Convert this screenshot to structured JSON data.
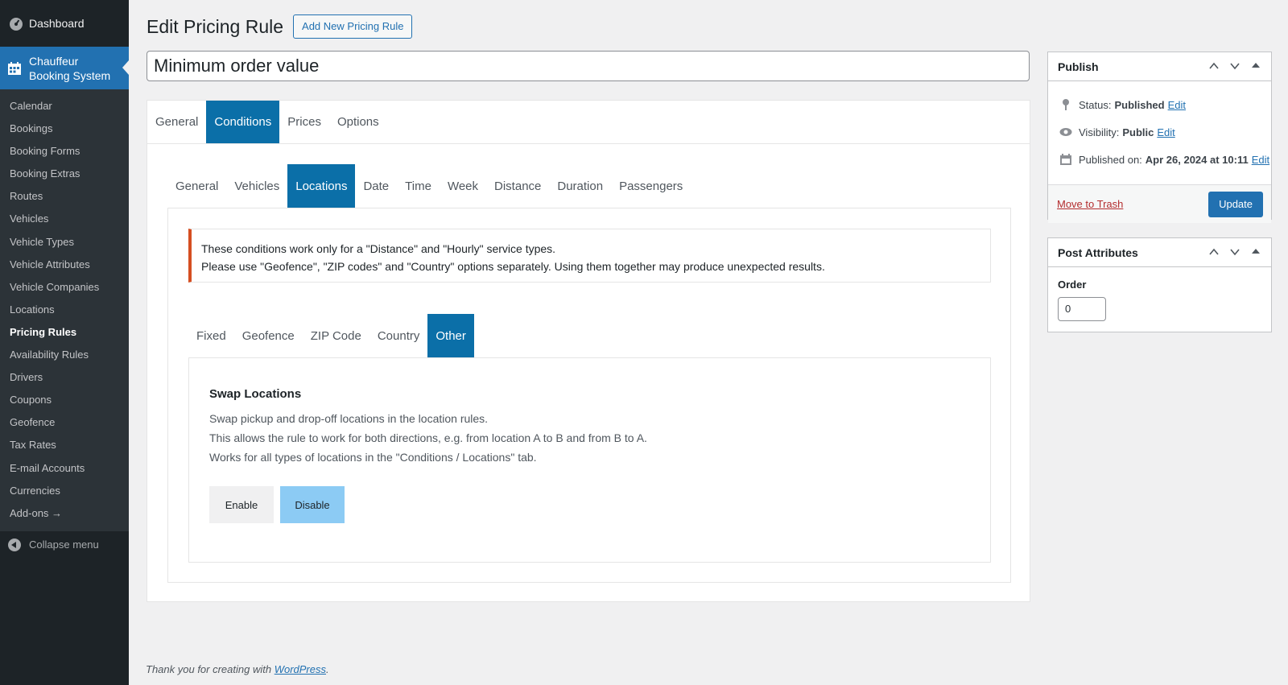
{
  "sidebar": {
    "dashboard": "Dashboard",
    "active_plugin": "Chauffeur Booking System",
    "items": [
      {
        "label": "Calendar"
      },
      {
        "label": "Bookings"
      },
      {
        "label": "Booking Forms"
      },
      {
        "label": "Booking Extras"
      },
      {
        "label": "Routes"
      },
      {
        "label": "Vehicles"
      },
      {
        "label": "Vehicle Types"
      },
      {
        "label": "Vehicle Attributes"
      },
      {
        "label": "Vehicle Companies"
      },
      {
        "label": "Locations"
      },
      {
        "label": "Pricing Rules"
      },
      {
        "label": "Availability Rules"
      },
      {
        "label": "Drivers"
      },
      {
        "label": "Coupons"
      },
      {
        "label": "Geofence"
      },
      {
        "label": "Tax Rates"
      },
      {
        "label": "E-mail Accounts"
      },
      {
        "label": "Currencies"
      },
      {
        "label": "Add-ons →"
      }
    ],
    "current": "Pricing Rules",
    "collapse": "Collapse menu"
  },
  "header": {
    "title": "Edit Pricing Rule",
    "add_new": "Add New Pricing Rule"
  },
  "post_title": "Minimum order value",
  "main_tabs": [
    "General",
    "Conditions",
    "Prices",
    "Options"
  ],
  "main_tab_active": "Conditions",
  "condition_tabs": [
    "General",
    "Vehicles",
    "Locations",
    "Date",
    "Time",
    "Week",
    "Distance",
    "Duration",
    "Passengers"
  ],
  "condition_tab_active": "Locations",
  "notice": {
    "line1": "These conditions work only for a \"Distance\" and \"Hourly\" service types.",
    "line2": "Please use \"Geofence\", \"ZIP codes\" and \"Country\" options separately. Using them together may produce unexpected results."
  },
  "location_tabs": [
    "Fixed",
    "Geofence",
    "ZIP Code",
    "Country",
    "Other"
  ],
  "location_tab_active": "Other",
  "other": {
    "title": "Swap Locations",
    "desc1": "Swap pickup and drop-off locations in the location rules.",
    "desc2": "This allows the rule to work for both directions, e.g. from location A to B and from B to A.",
    "desc3": "Works for all types of locations in the \"Conditions / Locations\" tab.",
    "enable": "Enable",
    "disable": "Disable",
    "selected": "Disable"
  },
  "publish": {
    "title": "Publish",
    "status_label": "Status:",
    "status_value": "Published",
    "visibility_label": "Visibility:",
    "visibility_value": "Public",
    "published_label": "Published on:",
    "published_value": "Apr 26, 2024 at 10:11",
    "edit": "Edit",
    "trash": "Move to Trash",
    "update": "Update"
  },
  "attributes": {
    "title": "Post Attributes",
    "order_label": "Order",
    "order_value": "0"
  },
  "footer": {
    "text": "Thank you for creating with ",
    "link": "WordPress",
    "end": "."
  },
  "colors": {
    "sidebar_bg": "#1d2327",
    "accent": "#2271b1",
    "tab_active": "#0b6fa8",
    "notice_border": "#d54e21",
    "disable_selected": "#8ccbf4"
  }
}
